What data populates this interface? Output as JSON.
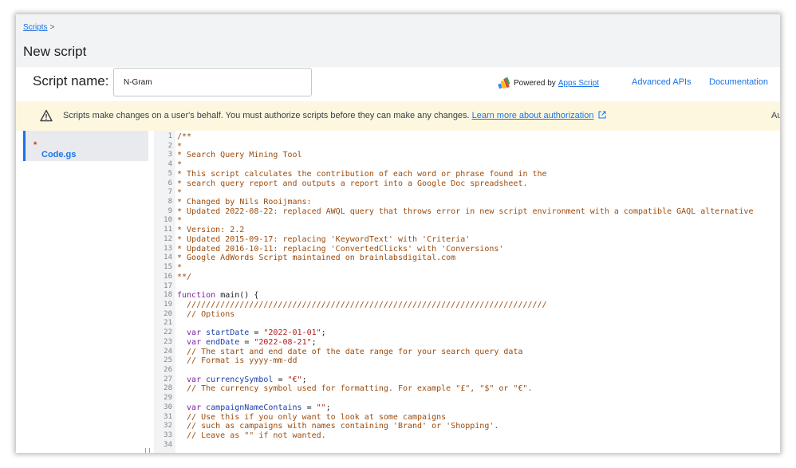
{
  "breadcrumb": {
    "link": "Scripts",
    "separator": ">"
  },
  "page_title": "New script",
  "script_name": {
    "label": "Script name:",
    "value": "N-Gram"
  },
  "header_links": {
    "powered_prefix": "Powered by",
    "powered_link": "Apps Script",
    "advanced_apis": "Advanced APIs",
    "documentation": "Documentation"
  },
  "banner": {
    "text": "Scripts make changes on a user's behalf. You must authorize scripts before they can make any changes.",
    "link": "Learn more about authorization",
    "cut_text": "Au"
  },
  "files": [
    {
      "name": "Code.gs",
      "modified_marker": "*"
    }
  ],
  "colors": {
    "accent": "#1a73e8",
    "banner_bg": "#fef7e0",
    "warning": "#ea8600",
    "comment": "#9c4b0c",
    "keyword": "#7b1fa2",
    "variable": "#1a3ea8",
    "string": "#b31b1b"
  },
  "icons": {
    "apps_script": "apps-script-icon",
    "warning": "warning-icon",
    "external_link": "external-link-icon"
  },
  "code_lines": [
    [
      [
        "c",
        "/**"
      ]
    ],
    [
      [
        "c",
        "*"
      ]
    ],
    [
      [
        "c",
        "* Search Query Mining Tool"
      ]
    ],
    [
      [
        "c",
        "*"
      ]
    ],
    [
      [
        "c",
        "* This script calculates the contribution of each word or phrase found in the"
      ]
    ],
    [
      [
        "c",
        "* search query report and outputs a report into a Google Doc spreadsheet."
      ]
    ],
    [
      [
        "c",
        "*"
      ]
    ],
    [
      [
        "c",
        "* Changed by Nils Rooijmans:"
      ]
    ],
    [
      [
        "c",
        "* Updated 2022-08-22: replaced AWQL query that throws error in new script environment with a compatible GAQL alternative"
      ]
    ],
    [
      [
        "c",
        "*"
      ]
    ],
    [
      [
        "c",
        "* Version: 2.2"
      ]
    ],
    [
      [
        "c",
        "* Updated 2015-09-17: replacing 'KeywordText' with 'Criteria'"
      ]
    ],
    [
      [
        "c",
        "* Updated 2016-10-11: replacing 'ConvertedClicks' with 'Conversions'"
      ]
    ],
    [
      [
        "c",
        "* Google AdWords Script maintained on brainlabsdigital.com"
      ]
    ],
    [
      [
        "c",
        "*"
      ]
    ],
    [
      [
        "c",
        "**/"
      ]
    ],
    [],
    [
      [
        "k",
        "function"
      ],
      [
        "p",
        " main() {"
      ]
    ],
    [
      [
        "c",
        "  ///////////////////////////////////////////////////////////////////////////"
      ]
    ],
    [
      [
        "c",
        "  // Options"
      ]
    ],
    [],
    [
      [
        "k",
        "  var"
      ],
      [
        "p",
        " "
      ],
      [
        "v",
        "startDate"
      ],
      [
        "p",
        " = "
      ],
      [
        "s",
        "\"2022-01-01\""
      ],
      [
        "p",
        ";"
      ]
    ],
    [
      [
        "k",
        "  var"
      ],
      [
        "p",
        " "
      ],
      [
        "v",
        "endDate"
      ],
      [
        "p",
        " = "
      ],
      [
        "s",
        "\"2022-08-21\""
      ],
      [
        "p",
        ";"
      ]
    ],
    [
      [
        "c",
        "  // The start and end date of the date range for your search query data"
      ]
    ],
    [
      [
        "c",
        "  // Format is yyyy-mm-dd"
      ]
    ],
    [],
    [
      [
        "k",
        "  var"
      ],
      [
        "p",
        " "
      ],
      [
        "v",
        "currencySymbol"
      ],
      [
        "p",
        " = "
      ],
      [
        "s",
        "\"€\""
      ],
      [
        "p",
        ";"
      ]
    ],
    [
      [
        "c",
        "  // The currency symbol used for formatting. For example \"£\", \"$\" or \"€\"."
      ]
    ],
    [],
    [
      [
        "k",
        "  var"
      ],
      [
        "p",
        " "
      ],
      [
        "v",
        "campaignNameContains"
      ],
      [
        "p",
        " = "
      ],
      [
        "s",
        "\"\""
      ],
      [
        "p",
        ";"
      ]
    ],
    [
      [
        "c",
        "  // Use this if you only want to look at some campaigns"
      ]
    ],
    [
      [
        "c",
        "  // such as campaigns with names containing 'Brand' or 'Shopping'."
      ]
    ],
    [
      [
        "c",
        "  // Leave as \"\" if not wanted."
      ]
    ],
    []
  ]
}
